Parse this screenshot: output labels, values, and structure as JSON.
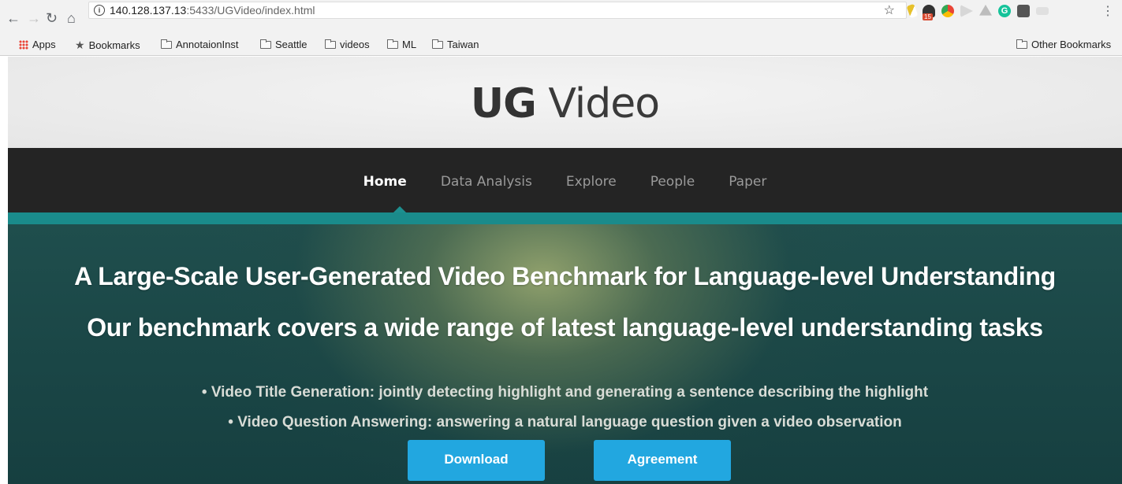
{
  "browser": {
    "url_host": "140.128.137.13",
    "url_rest": ":5433/UGVideo/index.html",
    "extension_badge": "15",
    "grammarly_letter": "G"
  },
  "bookmarks": {
    "items": [
      "Apps",
      "Bookmarks",
      "AnnotaionInst",
      "Seattle",
      "videos",
      "ML",
      "Taiwan"
    ],
    "other": "Other Bookmarks"
  },
  "site": {
    "title_bold": "UG",
    "title_light": "Video",
    "nav": [
      "Home",
      "Data Analysis",
      "Explore",
      "People",
      "Paper"
    ],
    "active_nav": "Home"
  },
  "hero": {
    "heading": "A Large-Scale User-Generated Video Benchmark for Language-level Understanding",
    "subheading": "Our benchmark covers a wide range of latest language-level understanding tasks",
    "bullets": [
      "• Video Title Generation: jointly detecting highlight and generating a sentence describing the highlight",
      "• Video Question Answering: answering a natural language question given a video observation"
    ],
    "buttons": {
      "download": "Download",
      "agreement": "Agreement"
    }
  },
  "colors": {
    "teal": "#1a8b8b",
    "button": "#22a7e0",
    "navbar": "#242424"
  }
}
